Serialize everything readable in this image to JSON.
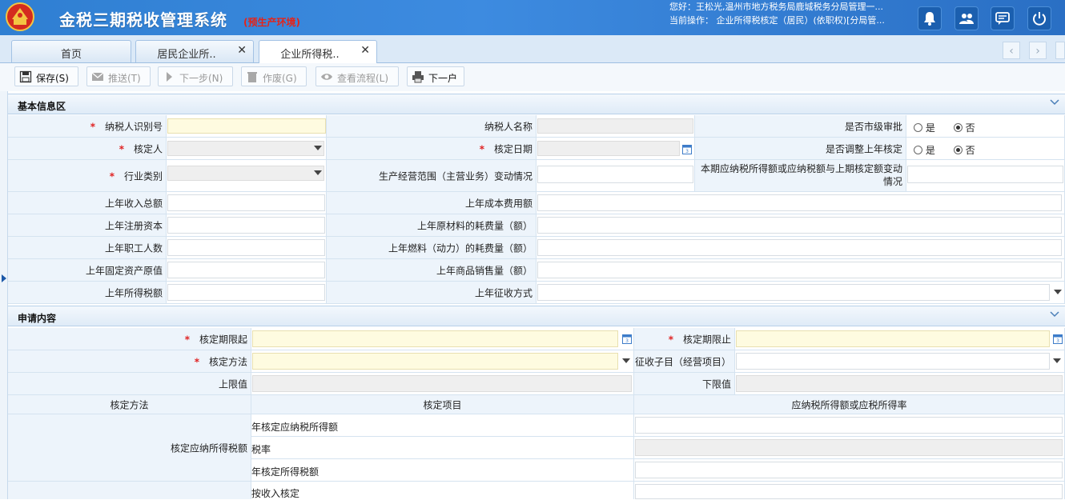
{
  "header": {
    "app_title": "金税三期税收管理系统",
    "env_label": "(预生产环境)",
    "user_info": "您好：王松光,温州市地方税务局鹿城税务分局管理一...",
    "current_op": "当前操作：  企业所得税核定（居民）(依职权)[分局管..."
  },
  "tabs": [
    {
      "label": "首页",
      "closable": false,
      "active": false
    },
    {
      "label": "居民企业所..",
      "closable": true,
      "active": false
    },
    {
      "label": "企业所得税..",
      "closable": true,
      "active": true
    }
  ],
  "tab_close_glyph": "✕",
  "toolbar": {
    "save": "保存(S)",
    "push": "推送(T)",
    "next_step": "下一步(N)",
    "void": "作废(G)",
    "view_flow": "查看流程(L)",
    "next_household": "下一户"
  },
  "section_basic": {
    "title": "基本信息区",
    "taxpayer_id_label": "纳税人识别号",
    "taxpayer_id_value": "",
    "taxpayer_name_label": "纳税人名称",
    "city_review_label": "是否市级审批",
    "approver_label": "核定人",
    "approve_date_label": "核定日期",
    "adjust_last_year_label": "是否调整上年核定",
    "industry_label": "行业类别",
    "scope_change_label": "生产经营范围（主营业务）变动情况",
    "tax_change_label": "本期应纳税所得额或应纳税额与上期核定额变动情况",
    "last_income_label": "上年收入总额",
    "last_cost_label": "上年成本费用额",
    "last_capital_label": "上年注册资本",
    "last_material_label": "上年原材料的耗费量（额）",
    "last_staff_label": "上年职工人数",
    "last_fuel_label": "上年燃料（动力）的耗费量（额）",
    "last_assets_label": "上年固定资产原值",
    "last_sales_label": "上年商品销售量（额）",
    "last_tax_label": "上年所得税额",
    "last_method_label": "上年征收方式",
    "yes": "是",
    "no": "否"
  },
  "section_apply": {
    "title": "申请内容",
    "period_start_label": "核定期限起",
    "period_end_label": "核定期限止",
    "method_label": "核定方法",
    "sub_item_label": "征收子目（经营项目）",
    "upper_label": "上限值",
    "lower_label": "下限值",
    "grid_header_method": "核定方法",
    "grid_header_item": "核定项目",
    "grid_header_rate": "应纳税所得额或应税所得率",
    "grid_method_value": "核定应纳所得税额",
    "grid_items": [
      "年核定应纳税所得额",
      "税率",
      "年核定所得税额",
      "按收入核定"
    ]
  },
  "colors": {
    "header_blue": "#2f7fd2",
    "required_bg": "#fefbe0",
    "required_star": "#e02020",
    "env_label": "#e52318"
  },
  "icons": {
    "bell": "bell-icon",
    "users": "users-icon",
    "chat": "chat-icon",
    "power": "power-icon"
  }
}
